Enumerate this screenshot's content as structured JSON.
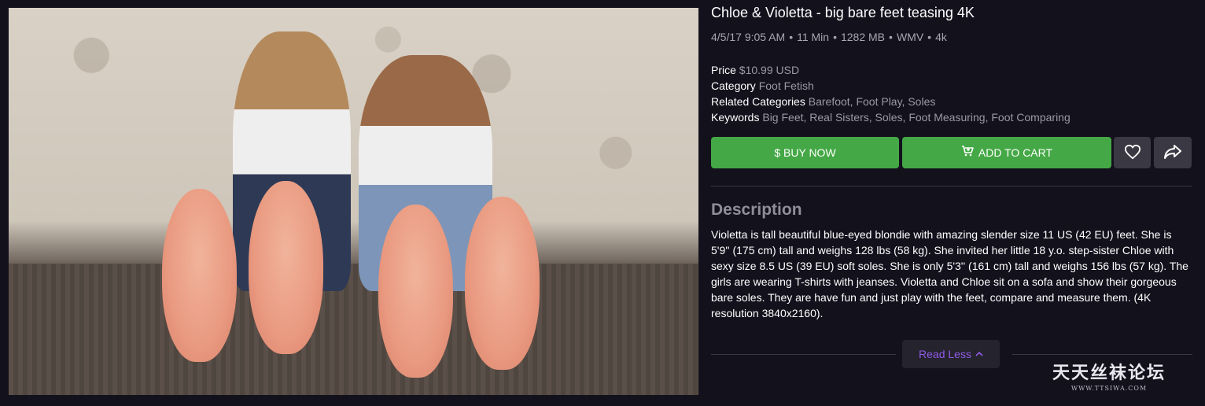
{
  "product": {
    "title": "Chloe & Violetta - big bare feet teasing 4K",
    "meta": {
      "date": "4/5/17 9:05 AM",
      "duration": "11 Min",
      "size": "1282 MB",
      "format": "WMV",
      "quality": "4k",
      "separator": "•"
    },
    "details": {
      "price_label": "Price",
      "price_value": "$10.99 USD",
      "category_label": "Category",
      "category_value": "Foot Fetish",
      "related_label": "Related Categories",
      "related_value": "Barefoot, Foot Play, Soles",
      "keywords_label": "Keywords",
      "keywords_value": "Big Feet, Real Sisters, Soles, Foot Measuring, Foot Comparing"
    }
  },
  "actions": {
    "buy_label": "$ BUY NOW",
    "cart_label": "ADD TO CART",
    "cart_icon": "cart-icon",
    "favorite_icon": "heart-icon",
    "share_icon": "share-arrow-icon"
  },
  "description": {
    "heading": "Description",
    "text": "Violetta is tall beautiful blue-eyed blondie with amazing slender size 11 US (42 EU) feet. She is 5'9'' (175 cm) tall and weighs 128 lbs (58 kg). She invited her little 18 y.o. step-sister Chloe with sexy size 8.5 US (39 EU) soft soles. She is only 5'3'' (161 cm) tall and weighs 156 lbs (57 kg). The girls are wearing T-shirts with jeanses. Violetta and Chloe sit on a sofa and show their gorgeous bare soles. They are have fun and just play with the feet, compare and measure them. (4K resolution 3840x2160).",
    "toggle_label": "Read Less",
    "toggle_icon": "chevron-up-icon"
  },
  "watermark": {
    "main": "天天丝袜论坛",
    "sub": "WWW.TTSIWA.COM"
  },
  "colors": {
    "background": "#13111c",
    "button_green": "#45a846",
    "button_dark": "#3a3842",
    "accent_purple": "#8f5be6",
    "muted_text": "#9b99a6"
  }
}
